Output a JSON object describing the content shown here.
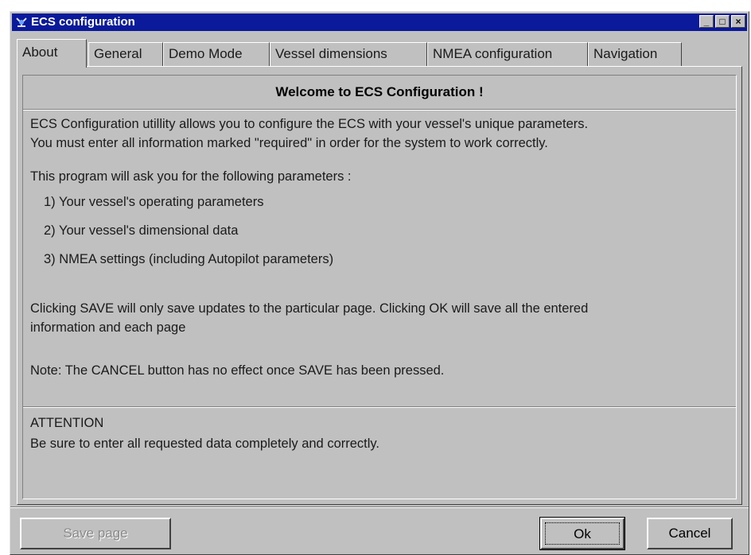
{
  "window": {
    "title": "ECS configuration",
    "controls": [
      "minimize-icon",
      "maximize-icon",
      "close-icon"
    ]
  },
  "tabs": [
    {
      "label": "About",
      "active": true
    },
    {
      "label": "General"
    },
    {
      "label": "Demo Mode"
    },
    {
      "label": "Vessel dimensions"
    },
    {
      "label": "NMEA configuration"
    },
    {
      "label": "Navigation"
    }
  ],
  "about": {
    "heading": "Welcome to ECS Configuration !",
    "intro_1": "ECS Configuration utillity allows you to configure the ECS with your vessel's unique parameters.",
    "intro_2": "You must enter all information marked \"required\" in order for the system to work correctly.",
    "list_intro": "This program will ask you for the following parameters :",
    "items": [
      "1) Your vessel's operating parameters",
      "2) Your vessel's dimensional data",
      "3) NMEA settings (including Autopilot parameters)"
    ],
    "save_note_1": "Clicking SAVE will only save updates to the particular page. Clicking OK will save all the entered",
    "save_note_2": "information and each page",
    "cancel_note": "Note:  The CANCEL button has no effect once SAVE has been pressed.",
    "attention_title": "ATTENTION",
    "attention_text": "Be sure to enter all requested data completely and correctly."
  },
  "buttons": {
    "save": "Save page",
    "ok": "Ok",
    "cancel": "Cancel"
  }
}
